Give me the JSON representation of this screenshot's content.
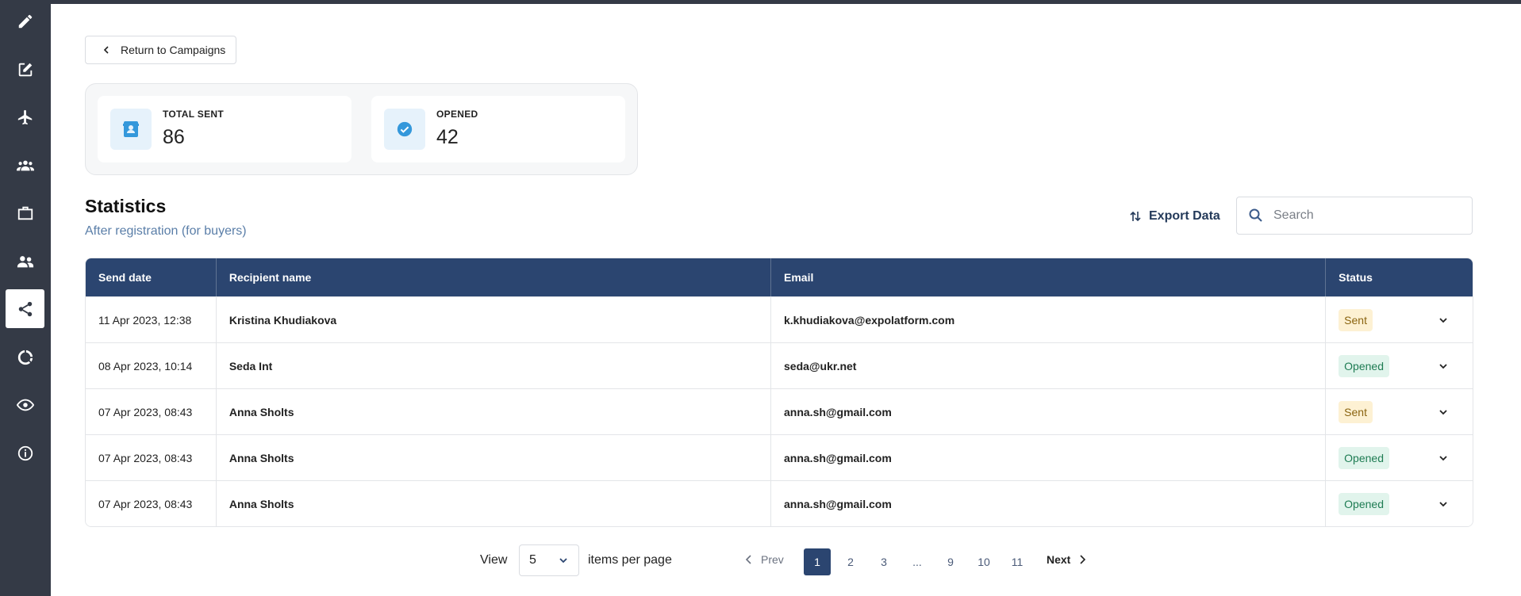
{
  "sidebar": {
    "items": [
      {
        "icon": "pencil-icon"
      },
      {
        "icon": "edit-square-icon"
      },
      {
        "icon": "airplane-icon"
      },
      {
        "icon": "group-icon"
      },
      {
        "icon": "briefcase-icon"
      },
      {
        "icon": "people-icon"
      },
      {
        "icon": "share-icon",
        "active": true
      },
      {
        "icon": "donut-chart-icon"
      },
      {
        "icon": "eye-icon"
      },
      {
        "icon": "info-icon"
      }
    ]
  },
  "back_button": {
    "label": "Return to Campaigns"
  },
  "stats": {
    "total_sent": {
      "label": "TOTAL SENT",
      "value": "86"
    },
    "opened": {
      "label": "OPENED",
      "value": "42"
    }
  },
  "heading": {
    "title": "Statistics",
    "subtitle": "After registration (for buyers)"
  },
  "export": {
    "label": "Export Data"
  },
  "search": {
    "placeholder": "Search",
    "value": ""
  },
  "table": {
    "columns": [
      "Send date",
      "Recipient name",
      "Email",
      "Status"
    ],
    "rows": [
      {
        "date": "11 Apr 2023, 12:38",
        "name": "Kristina Khudiakova",
        "email": "k.khudiakova@expolatform.com",
        "status": "Sent"
      },
      {
        "date": "08 Apr 2023, 10:14",
        "name": "Seda Int",
        "email": "seda@ukr.net",
        "status": "Opened"
      },
      {
        "date": "07 Apr 2023, 08:43",
        "name": "Anna Sholts",
        "email": "anna.sh@gmail.com",
        "status": "Sent"
      },
      {
        "date": "07 Apr 2023, 08:43",
        "name": "Anna Sholts",
        "email": "anna.sh@gmail.com",
        "status": "Opened"
      },
      {
        "date": "07 Apr 2023, 08:43",
        "name": "Anna Sholts",
        "email": "anna.sh@gmail.com",
        "status": "Opened"
      }
    ]
  },
  "pagination": {
    "view_label": "View",
    "per_page_value": "5",
    "per_page_label": "items per page",
    "prev_label": "Prev",
    "next_label": "Next",
    "pages": [
      "1",
      "2",
      "3",
      "...",
      "9",
      "10",
      "11"
    ],
    "current_page": "1"
  },
  "colors": {
    "sidebar": "#343a46",
    "header": "#2b4570",
    "accent": "#3498db",
    "sent_badge": "#fdf1d3",
    "opened_badge": "#e1f4ec"
  }
}
